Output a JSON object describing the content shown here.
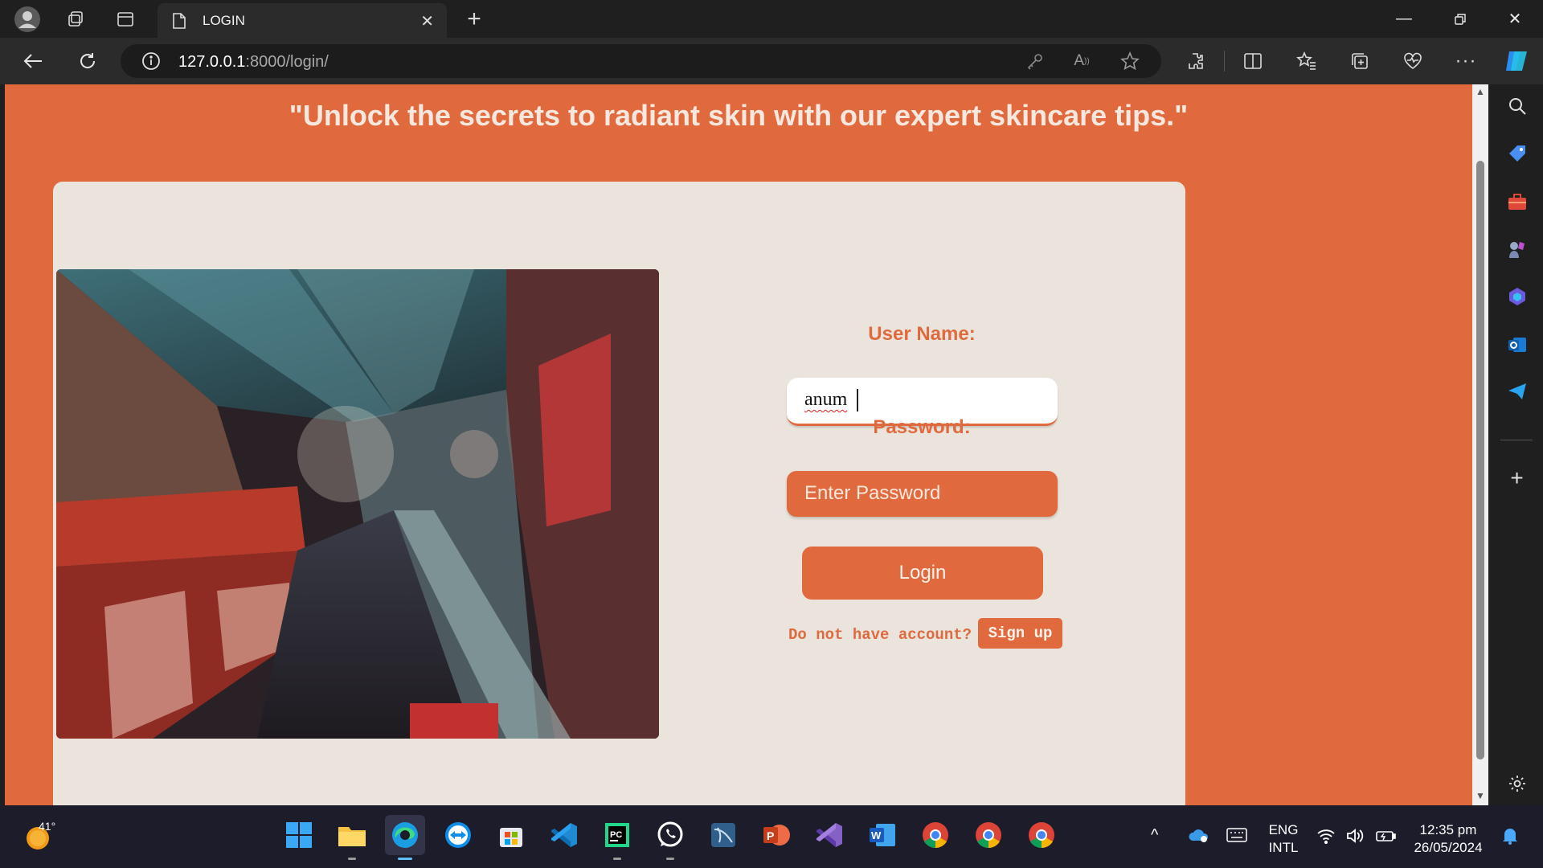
{
  "browser": {
    "tab_title": "LOGIN",
    "url_host": "127.0.0.1",
    "url_rest": ":8000/login/"
  },
  "page": {
    "tagline": "\"Unlock the secrets to radiant skin with our expert skincare tips.\"",
    "username_label": "User Name:",
    "username_value": "anum",
    "password_label": "Password:",
    "password_placeholder": "Enter Password",
    "login_label": "Login",
    "no_account_text": "Do not have account?",
    "signup_label": "Sign up",
    "hero_image": "shopping-mall-interior-photo"
  },
  "colors": {
    "accent": "#e06a3d",
    "card_bg": "#eae4dc",
    "browser_dark": "#1f1f1f"
  },
  "taskbar": {
    "weather_temp": "41°",
    "lang_line1": "ENG",
    "lang_line2": "INTL",
    "time": "12:35 pm",
    "date": "26/05/2024",
    "apps": [
      "start-icon",
      "file-explorer-icon",
      "edge-icon",
      "teamviewer-icon",
      "store-icon",
      "vscode-icon",
      "pycharm-icon",
      "whatsapp-icon",
      "mysql-workbench-icon",
      "powerpoint-icon",
      "visual-studio-icon",
      "word-icon",
      "chrome-icon",
      "chrome-icon",
      "chrome-icon"
    ]
  }
}
